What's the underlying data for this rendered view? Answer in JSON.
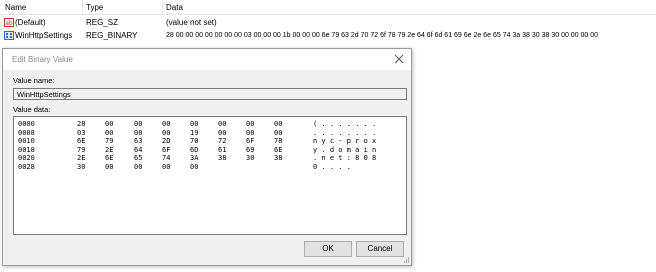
{
  "list": {
    "columns": {
      "name": "Name",
      "type": "Type",
      "data": "Data"
    },
    "rows": [
      {
        "icon": "string-value-icon",
        "name": "(Default)",
        "type": "REG_SZ",
        "data": "(value not set)"
      },
      {
        "icon": "binary-value-icon",
        "name": "WinHttpSettings",
        "type": "REG_BINARY",
        "data": "28 00 00 00 00 00 00 00 03 00 00 00 1b 00 00 00 6e 79 63 2d 70 72 6f 78 79 2e 64 6f 6d 61 69 6e 2e 6e 65 74 3a 38 30 38 30 00 00 00 00"
      }
    ]
  },
  "dialog": {
    "title": "Edit Binary Value",
    "value_name_label": "Value name:",
    "value_name": "WinHttpSettings",
    "value_data_label": "Value data:",
    "hex_rows": [
      {
        "offset": "0000",
        "bytes": [
          "28",
          "00",
          "00",
          "00",
          "00",
          "00",
          "00",
          "00"
        ],
        "ascii": "( . . . . . . ."
      },
      {
        "offset": "0008",
        "bytes": [
          "03",
          "00",
          "00",
          "00",
          "19",
          "00",
          "00",
          "00"
        ],
        "ascii": ". . . . . . . ."
      },
      {
        "offset": "0010",
        "bytes": [
          "6E",
          "79",
          "63",
          "2D",
          "70",
          "72",
          "6F",
          "78"
        ],
        "ascii": "n y c - p r o x"
      },
      {
        "offset": "0018",
        "bytes": [
          "79",
          "2E",
          "64",
          "6F",
          "6D",
          "61",
          "69",
          "6E"
        ],
        "ascii": "y . d o m a i n"
      },
      {
        "offset": "0020",
        "bytes": [
          "2E",
          "6E",
          "65",
          "74",
          "3A",
          "38",
          "30",
          "38"
        ],
        "ascii": ". n e t : 8 0 8"
      },
      {
        "offset": "0028",
        "bytes": [
          "30",
          "00",
          "00",
          "00",
          "00",
          "",
          "",
          ""
        ],
        "ascii": "0 . . . ."
      }
    ],
    "ok_label": "OK",
    "cancel_label": "Cancel"
  },
  "colors": {
    "icon_red": "#c0392b",
    "icon_blue": "#2b6cc4"
  }
}
